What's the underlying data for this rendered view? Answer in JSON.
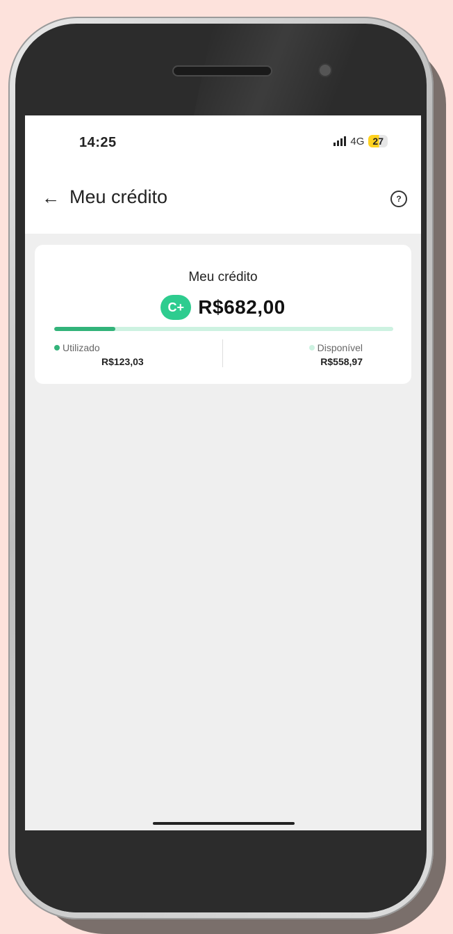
{
  "status_bar": {
    "time": "14:25",
    "network": "4G",
    "battery": "27"
  },
  "app_bar": {
    "title": "Meu crédito"
  },
  "credit_card": {
    "title": "Meu crédito",
    "badge": "C+",
    "total": "R$682,00",
    "used_fraction": 0.18,
    "used": {
      "label": "Utilizado",
      "value": "R$123,03",
      "color": "#33b37a"
    },
    "available": {
      "label": "Disponível",
      "value": "R$558,97",
      "color": "#cdf2e1"
    }
  },
  "colors": {
    "accent": "#2ecc8f",
    "background": "#fde2dc"
  }
}
